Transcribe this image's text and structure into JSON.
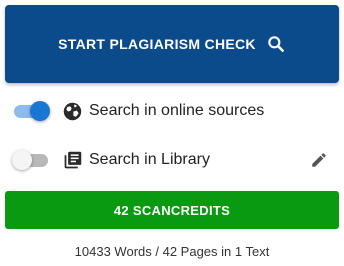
{
  "colors": {
    "primary_button": "#0b4a8b",
    "credits_button": "#0a9a12",
    "toggle_on": "#1976d2",
    "text": "#222222"
  },
  "start_button": {
    "label": "START PLAGIARISM CHECK",
    "icon": "search-icon"
  },
  "options": [
    {
      "label": "Search in online sources",
      "icon": "globe-icon",
      "enabled": true
    },
    {
      "label": "Search in Library",
      "icon": "library-icon",
      "enabled": false,
      "action_icon": "pencil-icon"
    }
  ],
  "credits_button": {
    "label": "42 SCANCREDITS"
  },
  "summary": "10433 Words / 42 Pages in 1 Text"
}
